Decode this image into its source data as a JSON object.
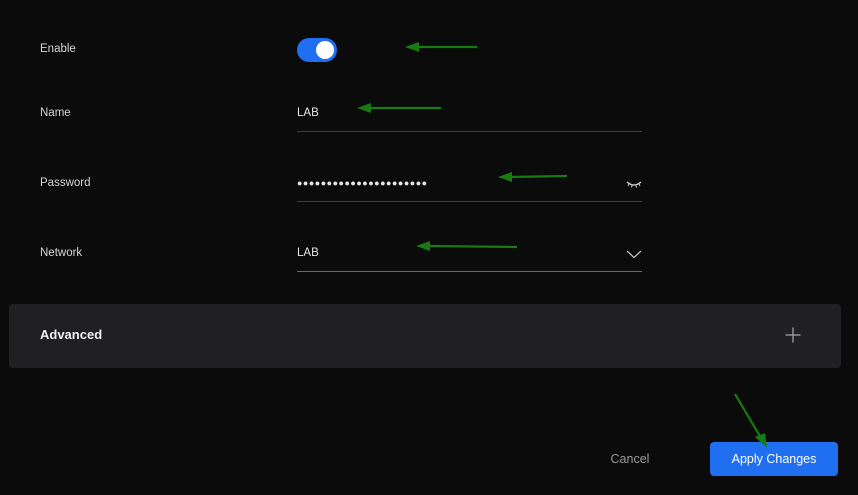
{
  "form": {
    "enable": {
      "label": "Enable",
      "state": "on"
    },
    "name": {
      "label": "Name",
      "value": "LAB"
    },
    "password": {
      "label": "Password",
      "value": "●●●●●●●●●●●●●●●●●●●●●●"
    },
    "network": {
      "label": "Network",
      "value": "LAB"
    }
  },
  "advanced": {
    "title": "Advanced"
  },
  "footer": {
    "cancel_label": "Cancel",
    "apply_label": "Apply Changes"
  },
  "colors": {
    "background": "#0b0b0c",
    "accent": "#1f6ff0",
    "annotation_arrow": "#1a7a12"
  }
}
